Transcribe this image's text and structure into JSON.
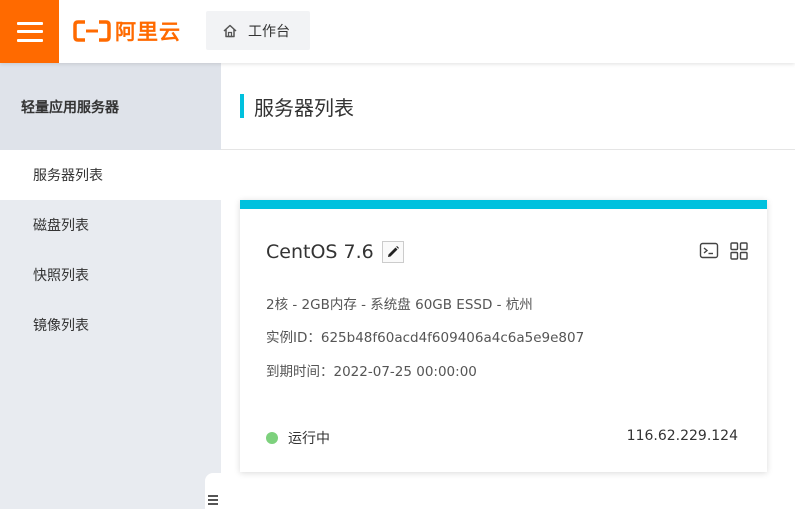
{
  "header": {
    "logo_text": "阿里云",
    "workbench_label": "工作台",
    "brand_color": "#ff6a00"
  },
  "sidebar": {
    "title": "轻量应用服务器",
    "items": [
      {
        "label": "服务器列表",
        "active": true
      },
      {
        "label": "磁盘列表",
        "active": false
      },
      {
        "label": "快照列表",
        "active": false
      },
      {
        "label": "镜像列表",
        "active": false
      }
    ]
  },
  "main": {
    "page_title": "服务器列表",
    "accent_color": "#00c1de",
    "server": {
      "os": "CentOS 7.6",
      "spec": "2核 - 2GB内存 - 系统盘 60GB ESSD - 杭州",
      "instance_id": "实例ID：625b48f60acd4f609406a4c6a5e9e807",
      "expiry": "到期时间：2022-07-25 00:00:00",
      "status": "运行中",
      "status_color": "#7dd17d",
      "ip": "116.62.229.124"
    }
  },
  "icons": [
    "menu-icon",
    "home-icon",
    "edit-icon",
    "terminal-icon",
    "grid-icon",
    "collapse-icon"
  ]
}
